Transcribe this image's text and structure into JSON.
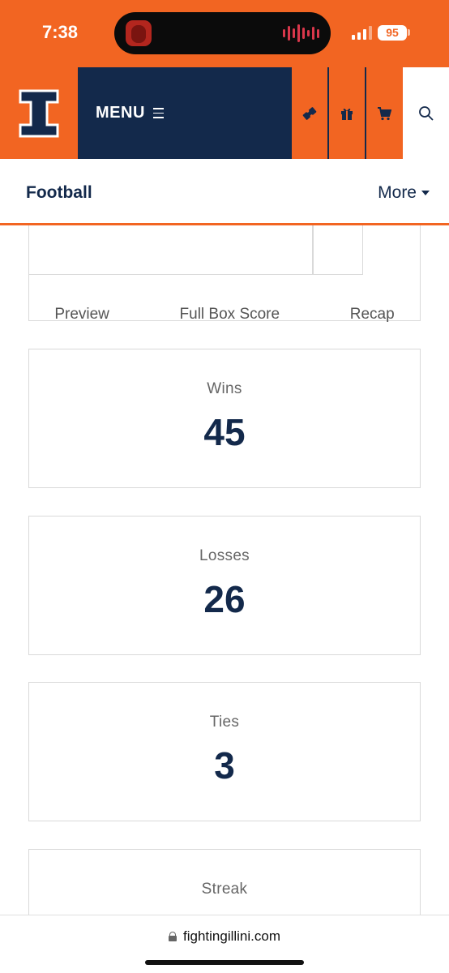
{
  "status_bar": {
    "time": "7:38",
    "battery": "95"
  },
  "header": {
    "logo": "illinois-block-i-logo",
    "menu_label": "MENU",
    "icons": [
      "ticket-icon",
      "gift-icon",
      "cart-icon",
      "search-icon"
    ],
    "colors": {
      "orange": "#f26522",
      "navy": "#13294b"
    }
  },
  "subnav": {
    "title": "Football",
    "more_label": "More"
  },
  "game_links": [
    "Preview",
    "Full Box Score",
    "Recap"
  ],
  "stats": [
    {
      "label": "Wins",
      "value": "45"
    },
    {
      "label": "Losses",
      "value": "26"
    },
    {
      "label": "Ties",
      "value": "3"
    },
    {
      "label": "Streak",
      "value": ""
    }
  ],
  "browser": {
    "url": "fightingillini.com"
  }
}
